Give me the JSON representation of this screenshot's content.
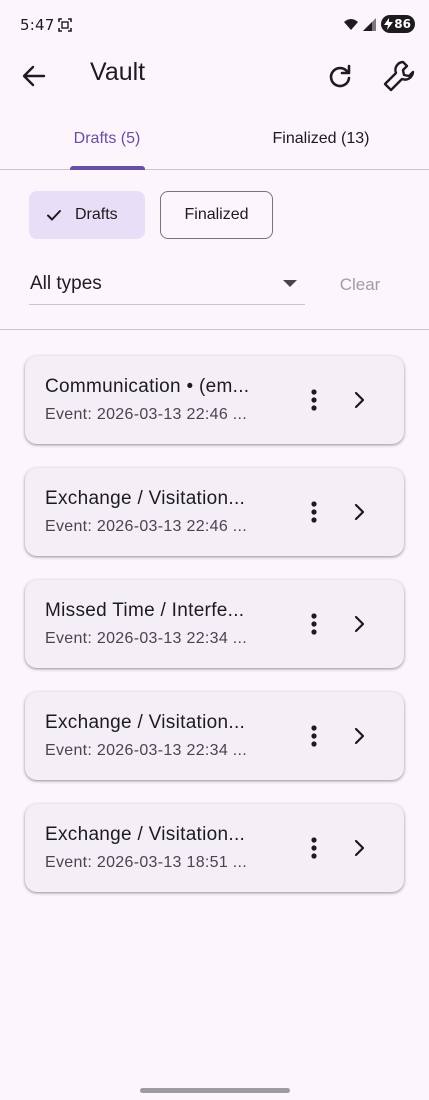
{
  "status_bar": {
    "time": "5:47",
    "battery": "86"
  },
  "app_bar": {
    "title": "Vault"
  },
  "tabs": [
    {
      "label": "Drafts (5)",
      "selected": true
    },
    {
      "label": "Finalized (13)",
      "selected": false
    }
  ],
  "chips": {
    "drafts_label": "Drafts",
    "finalized_label": "Finalized"
  },
  "filter": {
    "type_value": "All types",
    "clear_label": "Clear"
  },
  "drafts": [
    {
      "title": "Communication • (em...",
      "subtitle": "Event: 2026-03-13 22:46 ..."
    },
    {
      "title": "Exchange / Visitation...",
      "subtitle": "Event: 2026-03-13 22:46 ..."
    },
    {
      "title": "Missed Time / Interfe...",
      "subtitle": "Event: 2026-03-13 22:34 ..."
    },
    {
      "title": "Exchange / Visitation...",
      "subtitle": "Event: 2026-03-13 22:34 ..."
    },
    {
      "title": "Exchange / Visitation...",
      "subtitle": "Event: 2026-03-13 18:51 ..."
    }
  ],
  "icons": {
    "back": "arrow-back-icon",
    "refresh": "refresh-icon",
    "settings": "wrench-icon",
    "check": "check-icon",
    "dropdown": "arrow-drop-down-icon",
    "more": "more-vert-icon",
    "open": "chevron-right-icon"
  },
  "colors": {
    "primary": "#6750a4",
    "chip_selected": "#e8def8",
    "card_bg": "#f4eef6",
    "background": "#fdf5fc"
  }
}
